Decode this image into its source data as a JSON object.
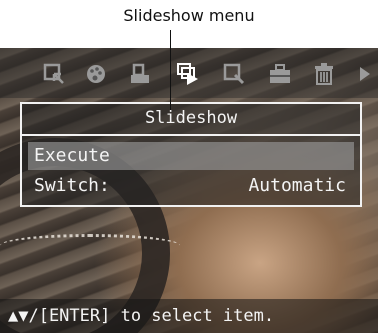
{
  "callout": {
    "label": "Slideshow menu"
  },
  "toolbar": {
    "icons": [
      "select-icon",
      "palette-icon",
      "print-icon",
      "slideshow-icon",
      "zoom-icon",
      "tools-icon",
      "trash-icon",
      "next-arrow-icon"
    ],
    "active_icon": "slideshow-icon"
  },
  "menu": {
    "title": "Slideshow",
    "items": [
      {
        "label": "Execute",
        "value": "",
        "selected": true
      },
      {
        "label": "Switch:",
        "value": "Automatic",
        "selected": false
      }
    ]
  },
  "status": {
    "hint": "▲▼/[ENTER] to select item."
  },
  "colors": {
    "menu_border": "#f2f2f2",
    "selected_row": "#969696",
    "inactive_icon": "#9a9a9a"
  }
}
